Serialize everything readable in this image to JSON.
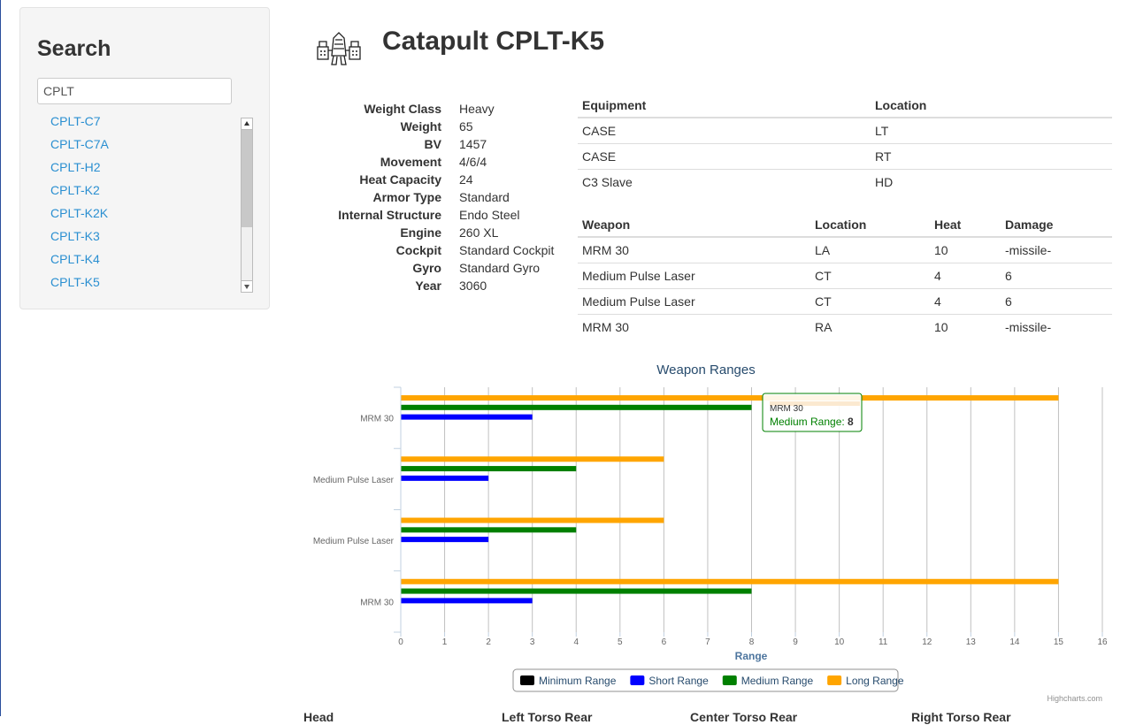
{
  "sidebar": {
    "heading": "Search",
    "search_value": "CPLT",
    "results": [
      "CPLT-C7",
      "CPLT-C7A",
      "CPLT-H2",
      "CPLT-K2",
      "CPLT-K2K",
      "CPLT-K3",
      "CPLT-K4",
      "CPLT-K5"
    ]
  },
  "mech": {
    "title": "Catapult CPLT-K5",
    "specs": [
      {
        "label": "Weight Class",
        "value": "Heavy"
      },
      {
        "label": "Weight",
        "value": "65"
      },
      {
        "label": "BV",
        "value": "1457"
      },
      {
        "label": "Movement",
        "value": "4/6/4"
      },
      {
        "label": "Heat Capacity",
        "value": "24"
      },
      {
        "label": "Armor Type",
        "value": "Standard"
      },
      {
        "label": "Internal Structure",
        "value": "Endo Steel"
      },
      {
        "label": "Engine",
        "value": "260 XL"
      },
      {
        "label": "Cockpit",
        "value": "Standard Cockpit"
      },
      {
        "label": "Gyro",
        "value": "Standard Gyro"
      },
      {
        "label": "Year",
        "value": "3060"
      }
    ]
  },
  "equipment": {
    "headers": [
      "Equipment",
      "Location"
    ],
    "rows": [
      [
        "CASE",
        "LT"
      ],
      [
        "CASE",
        "RT"
      ],
      [
        "C3 Slave",
        "HD"
      ]
    ]
  },
  "weapons": {
    "headers": [
      "Weapon",
      "Location",
      "Heat",
      "Damage"
    ],
    "rows": [
      [
        "MRM 30",
        "LA",
        "10",
        "-missile-"
      ],
      [
        "Medium Pulse Laser",
        "CT",
        "4",
        "6"
      ],
      [
        "Medium Pulse Laser",
        "CT",
        "4",
        "6"
      ],
      [
        "MRM 30",
        "RA",
        "10",
        "-missile-"
      ]
    ]
  },
  "chart_data": {
    "type": "bar",
    "orientation": "horizontal",
    "title": "Weapon Ranges",
    "xlabel": "Range",
    "xlim": [
      0,
      16
    ],
    "ticks": [
      "0",
      "1",
      "2",
      "3",
      "4",
      "5",
      "6",
      "7",
      "8",
      "9",
      "10",
      "11",
      "12",
      "13",
      "14",
      "15",
      "16"
    ],
    "categories": [
      "MRM 30",
      "Medium Pulse Laser",
      "Medium Pulse Laser",
      "MRM 30"
    ],
    "series": [
      {
        "name": "Minimum Range",
        "color": "#000000",
        "values": [
          0,
          0,
          0,
          0
        ]
      },
      {
        "name": "Short Range",
        "color": "#0000ff",
        "values": [
          3,
          2,
          2,
          3
        ]
      },
      {
        "name": "Medium Range",
        "color": "#008000",
        "values": [
          8,
          4,
          4,
          8
        ]
      },
      {
        "name": "Long Range",
        "color": "#ffa500",
        "values": [
          15,
          6,
          6,
          15
        ]
      }
    ],
    "legend_position": "bottom-center",
    "grid": true,
    "credit": "Highcharts.com",
    "tooltip": {
      "category": "MRM 30",
      "series": "Medium Range",
      "label": "Medium Range: ",
      "value": "8"
    }
  },
  "bottom_headers": [
    "Head",
    "Left Torso Rear",
    "Center Torso Rear",
    "Right Torso Rear"
  ]
}
